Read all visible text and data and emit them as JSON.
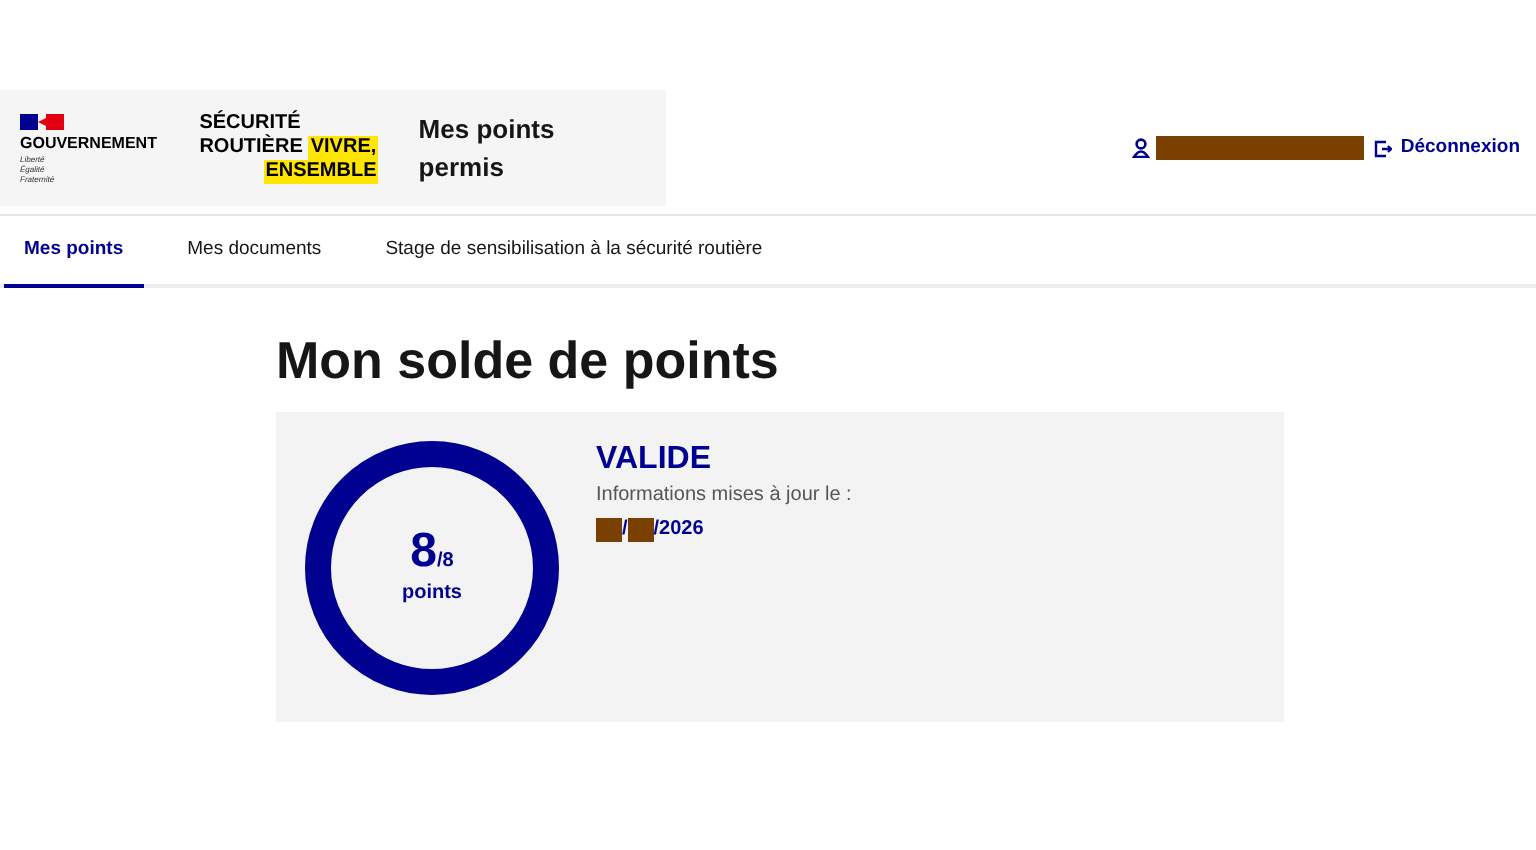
{
  "header": {
    "government": {
      "label": "GOUVERNEMENT",
      "motto": [
        "Liberté",
        "Égalité",
        "Fraternité"
      ]
    },
    "brand": {
      "line_1": "SÉCURITÉ",
      "line_2": "ROUTIÈRE",
      "highlight_1": "VIVRE,",
      "highlight_2": "ENSEMBLE"
    },
    "service_title": "Mes points permis",
    "user": {
      "redacted": true
    },
    "logout": "Déconnexion"
  },
  "tabs": [
    {
      "label": "Mes points",
      "selected": true
    },
    {
      "label": "Mes documents",
      "selected": false
    },
    {
      "label": "Stage de sensibilisation à la sécurité routière",
      "selected": false
    }
  ],
  "page_title": "Mon solde de points",
  "balance": {
    "points": "8",
    "max": "/8",
    "unit": "points",
    "level": 1,
    "status": "VALIDE",
    "updated_label": "Informations mises à jour le :",
    "date_parts": [
      {
        "kind": "redacted"
      },
      {
        "kind": "text",
        "text": "/"
      },
      {
        "kind": "redacted"
      },
      {
        "kind": "text",
        "text": "/2026"
      }
    ]
  }
}
